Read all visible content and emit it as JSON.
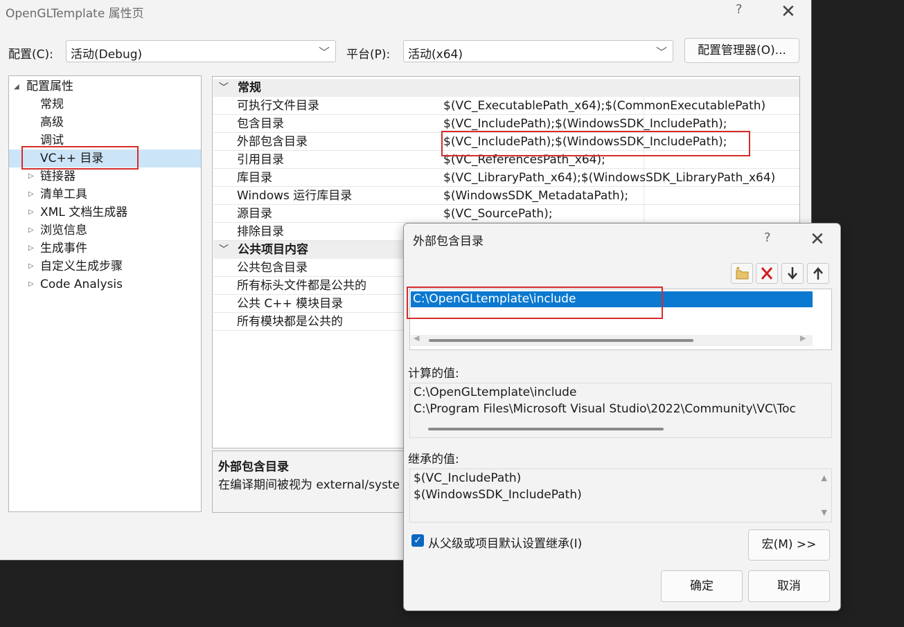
{
  "window": {
    "title": "OpenGLTemplate 属性页",
    "help": "?",
    "close": "✕"
  },
  "config": {
    "label": "配置(C):",
    "value": "活动(Debug)"
  },
  "platform": {
    "label": "平台(P):",
    "value": "活动(x64)"
  },
  "config_manager_button": "配置管理器(O)...",
  "tree": {
    "root": "配置属性",
    "items": [
      "常规",
      "高级",
      "调试",
      "VC++ 目录",
      "链接器",
      "清单工具",
      "XML 文档生成器",
      "浏览信息",
      "生成事件",
      "自定义生成步骤",
      "Code Analysis"
    ]
  },
  "grid": {
    "cat1": "常规",
    "rows1": [
      {
        "name": "可执行文件目录",
        "value": "$(VC_ExecutablePath_x64);$(CommonExecutablePath)"
      },
      {
        "name": "包含目录",
        "value": "$(VC_IncludePath);$(WindowsSDK_IncludePath);"
      },
      {
        "name": "外部包含目录",
        "value": "$(VC_IncludePath);$(WindowsSDK_IncludePath);"
      },
      {
        "name": "引用目录",
        "value": "$(VC_ReferencesPath_x64);"
      },
      {
        "name": "库目录",
        "value": "$(VC_LibraryPath_x64);$(WindowsSDK_LibraryPath_x64)"
      },
      {
        "name": "Windows 运行库目录",
        "value": "$(WindowsSDK_MetadataPath);"
      },
      {
        "name": "源目录",
        "value": "$(VC_SourcePath);"
      },
      {
        "name": "排除目录",
        "value": ""
      }
    ],
    "cat2": "公共项目内容",
    "rows2": [
      {
        "name": "公共包含目录",
        "value": ""
      },
      {
        "name": "所有标头文件都是公共的",
        "value": ""
      },
      {
        "name": "公共 C++ 模块目录",
        "value": ""
      },
      {
        "name": "所有模块都是公共的",
        "value": ""
      }
    ]
  },
  "description": {
    "title": "外部包含目录",
    "text": "在编译期间被视为 external/syste"
  },
  "dialog": {
    "title": "外部包含目录",
    "help": "?",
    "close": "✕",
    "list_items": [
      "C:\\OpenGLtemplate\\include"
    ],
    "computed_label": "计算的值:",
    "computed_values": [
      "C:\\OpenGLtemplate\\include",
      "C:\\Program Files\\Microsoft Visual Studio\\2022\\Community\\VC\\Toc"
    ],
    "inherited_label": "继承的值:",
    "inherited_values": [
      "$(VC_IncludePath)",
      "$(WindowsSDK_IncludePath)"
    ],
    "inherit_checkbox_label": "从父级或项目默认设置继承(I)",
    "inherit_checked": true,
    "macro_button": "宏(M) >>",
    "ok_button": "确定",
    "cancel_button": "取消"
  },
  "colors": {
    "accent": "#0b79d0",
    "highlight": "#d62b2b",
    "tree_selected": "#cce4f7"
  }
}
